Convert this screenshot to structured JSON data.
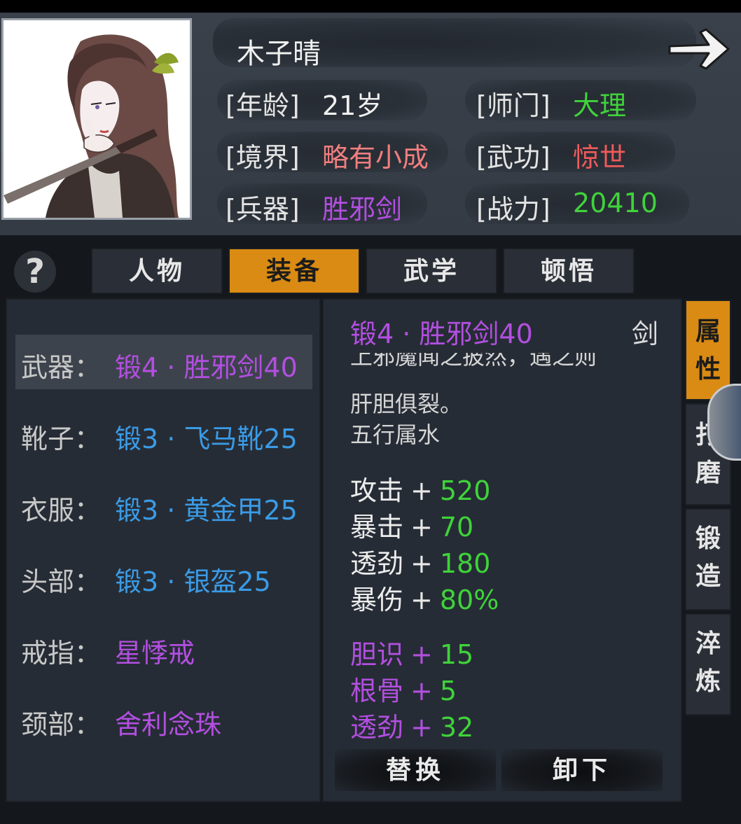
{
  "character": {
    "name": "木子晴",
    "info": [
      {
        "label": "[年龄]",
        "value": "21岁",
        "color": "#f0f0f0"
      },
      {
        "label": "[师门]",
        "value": "大理",
        "color": "#3fd33a"
      },
      {
        "label": "[境界]",
        "value": "略有小成",
        "color": "#f07f7f"
      },
      {
        "label": "[武功]",
        "value": "惊世",
        "color": "#ef5a5a"
      },
      {
        "label": "[兵器]",
        "value": "胜邪剑",
        "color": "#b24fe0"
      },
      {
        "label": "[战力]",
        "value": "20410",
        "color": "#3fd33a"
      }
    ]
  },
  "help": {
    "label": "?"
  },
  "tabs": [
    {
      "label": "人物",
      "active": false
    },
    {
      "label": "装备",
      "active": true
    },
    {
      "label": "武学",
      "active": false
    },
    {
      "label": "顿悟",
      "active": false
    }
  ],
  "equipment": {
    "slots": [
      {
        "label": "武器：",
        "value": "锻4 · 胜邪剑40",
        "color": "#b24fe0",
        "selected": true
      },
      {
        "label": "靴子：",
        "value": "锻3 · 飞马靴25",
        "color": "#3a9be6",
        "selected": false
      },
      {
        "label": "衣服：",
        "value": "锻3 · 黄金甲25",
        "color": "#3a9be6",
        "selected": false
      },
      {
        "label": "头部：",
        "value": "锻3 · 银盔25",
        "color": "#3a9be6",
        "selected": false
      },
      {
        "label": "戒指：",
        "value": "星悸戒",
        "color": "#b24fe0",
        "selected": false
      },
      {
        "label": "颈部：",
        "value": "舍利念珠",
        "color": "#b24fe0",
        "selected": false
      }
    ]
  },
  "detail": {
    "title": "锻4 · 胜邪剑40",
    "type": "剑",
    "desc_cut": "上邪魔闻之披然，遇之则",
    "desc_lines": [
      "肝胆俱裂。",
      "五行属水"
    ],
    "base_stats": [
      {
        "name": "攻击",
        "sign": "+",
        "value": "520"
      },
      {
        "name": "暴击",
        "sign": "+",
        "value": "70"
      },
      {
        "name": "透劲",
        "sign": "+",
        "value": "180"
      },
      {
        "name": "暴伤",
        "sign": "+",
        "value": "80%"
      }
    ],
    "bonus_stats": [
      {
        "name": "胆识",
        "sign": "+",
        "value": "15"
      },
      {
        "name": "根骨",
        "sign": "+",
        "value": "5"
      },
      {
        "name": "透劲",
        "sign": "+",
        "value": "32"
      }
    ],
    "replace_label": "替换",
    "unequip_label": "卸下"
  },
  "side_tabs": [
    {
      "chars": [
        "属",
        "性"
      ],
      "active": true
    },
    {
      "chars": [
        "打",
        "磨"
      ],
      "active": false
    },
    {
      "chars": [
        "锻",
        "造"
      ],
      "active": false
    },
    {
      "chars": [
        "淬",
        "炼"
      ],
      "active": false
    }
  ],
  "colors": {
    "accent": "#d98b13",
    "purple": "#b24fe0",
    "blue": "#3a9be6",
    "green": "#3fd33a",
    "red": "#ef5a5a"
  },
  "icons": {
    "next": "arrow-right-icon",
    "help": "question-icon"
  }
}
